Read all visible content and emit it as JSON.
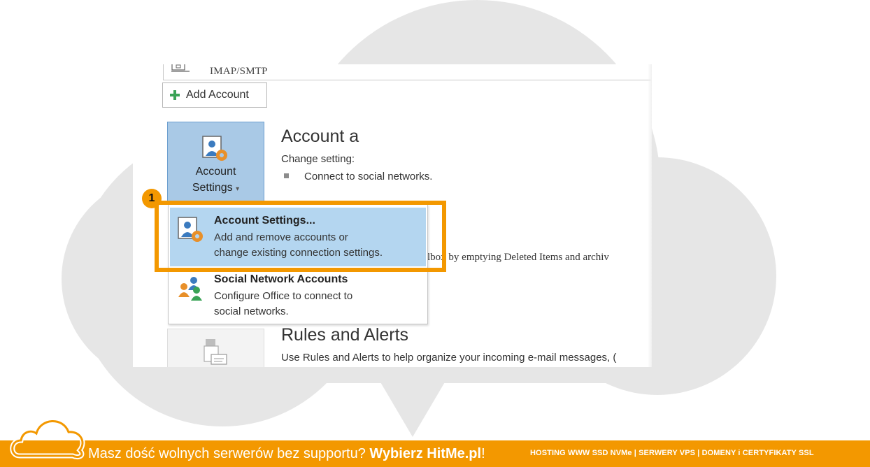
{
  "account_list": {
    "imap_label": "IMAP/SMTP"
  },
  "toolbar": {
    "add_account_label": "Add Account"
  },
  "account_settings_button": {
    "line1": "Account",
    "line2": "Settings",
    "caret": "▾"
  },
  "sections": {
    "account_title": "Account a",
    "account_desc": "Change setting:",
    "account_bullet": "Connect to social networks.",
    "cleanup_desc": "lbox by emptying Deleted Items and archiv",
    "rules_title": "Rules and Alerts",
    "rules_desc": "Use Rules and Alerts to help organize your incoming e-mail messages, ("
  },
  "dropdown": {
    "items": [
      {
        "title": "Account Settings...",
        "desc_line1": "Add and remove accounts or",
        "desc_line2": "change existing connection settings.",
        "icon": "account-settings-icon",
        "selected": true
      },
      {
        "title": "Social Network Accounts",
        "desc_line1": "Configure Office to connect to",
        "desc_line2": "social networks.",
        "icon": "social-network-icon",
        "selected": false
      }
    ]
  },
  "annotation": {
    "step_number": "1",
    "color": "#f39800"
  },
  "footer": {
    "promo_text": "Masz dość wolnych serwerów bez supportu?",
    "brand_text": "Wybierz HitMe.pl",
    "brand_suffix": "!",
    "services": "HOSTING WWW SSD NVMe | SERWERY VPS | DOMENY i CERTYFIKATY SSL",
    "color": "#f39800"
  }
}
